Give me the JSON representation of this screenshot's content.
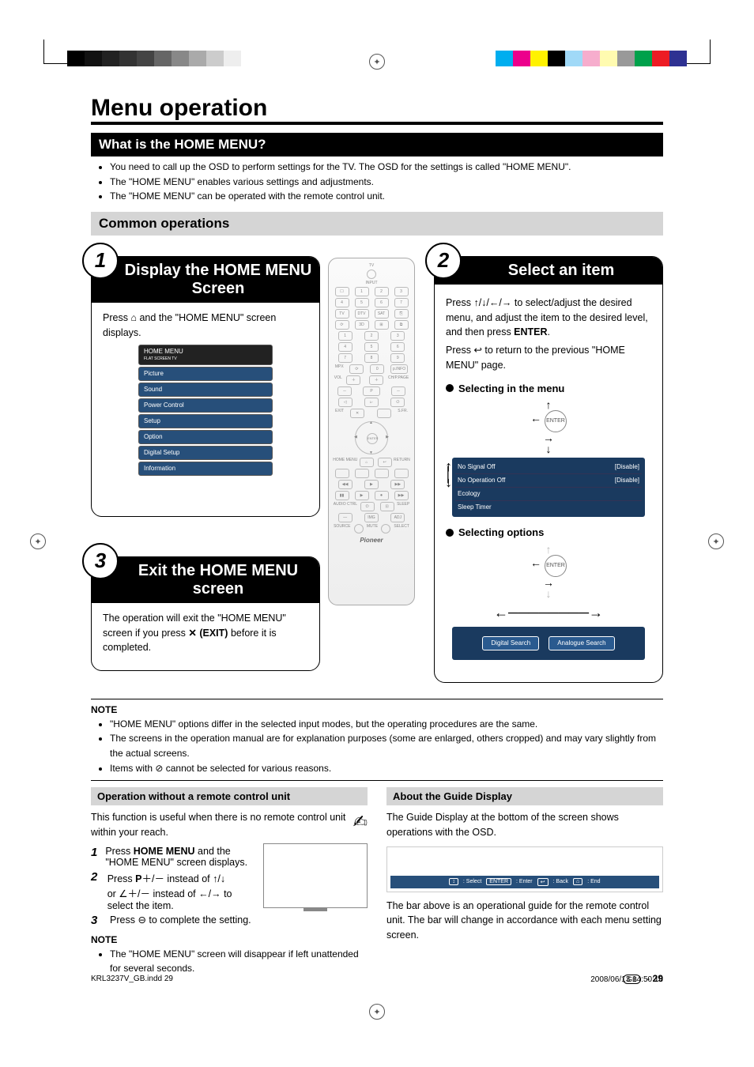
{
  "title": "Menu operation",
  "section1": {
    "heading": "What is the HOME MENU?",
    "bullets": [
      "You need to call up the OSD to perform settings for the TV. The OSD for the settings is called \"HOME MENU\".",
      "The \"HOME MENU\" enables various settings and adjustments.",
      "The \"HOME MENU\" can be operated with the remote control unit."
    ]
  },
  "section2": {
    "heading": "Common operations"
  },
  "step1": {
    "num": "1",
    "title": "Display the HOME MENU Screen",
    "text_a": "Press ",
    "text_b": " and the \"HOME MENU\" screen displays.",
    "menu": {
      "header": "HOME MENU",
      "header_sub": "FLAT SCREEN TV",
      "items": [
        "Picture",
        "Sound",
        "Power Control",
        "Setup",
        "Option",
        "Digital Setup",
        "Information"
      ]
    }
  },
  "step2": {
    "num": "2",
    "title": "Select an item",
    "text1_a": "Press ",
    "text1_b": " to select/adjust the desired menu, and adjust the item to the desired level, and then press ",
    "text1_enter": "ENTER",
    "text1_c": ".",
    "text2_a": "Press ",
    "text2_b": " to return to the previous \"HOME MENU\" page.",
    "sub1": "Selecting in the menu",
    "nav_label": "ENTER",
    "menu_sample": [
      {
        "l": "No Signal Off",
        "r": "[Disable]"
      },
      {
        "l": "No Operation Off",
        "r": "[Disable]"
      },
      {
        "l": "Ecology",
        "r": ""
      },
      {
        "l": "Sleep Timer",
        "r": ""
      }
    ],
    "sub2": "Selecting options",
    "options": [
      "Digital Search",
      "Analogue Search"
    ]
  },
  "step3": {
    "num": "3",
    "title": "Exit the HOME MENU screen",
    "text_a": "The operation will exit the \"HOME MENU\" screen if you press ",
    "exit_label": "(EXIT)",
    "text_b": " before it is completed."
  },
  "notes_after_diagram": {
    "heading": "NOTE",
    "bullets": [
      "\"HOME MENU\" options differ in the selected input modes, but the operating procedures are the same.",
      "The screens in the operation manual are for explanation purposes (some are enlarged, others cropped) and may vary slightly from the actual screens.",
      "Items with ⊘ cannot be selected for various reasons."
    ]
  },
  "left_sub": {
    "heading": "Operation without a remote control unit",
    "intro": "This function is useful when there is no remote control unit within your reach.",
    "steps": {
      "s1_a": "Press ",
      "s1_btn": "HOME MENU",
      "s1_b": " and the \"HOME MENU\" screen displays.",
      "s2_a": "Press ",
      "s2_p": "P",
      "s2_b": "＋/－ instead of ",
      "s2_c": " or ",
      "s2_d": "＋/－ instead of ",
      "s2_e": " to select the item.",
      "s3_a": "Press ",
      "s3_b": " to complete the setting."
    },
    "note_heading": "NOTE",
    "note_bullets": [
      "The \"HOME MENU\" screen will disappear if left unattended for several seconds."
    ]
  },
  "right_sub": {
    "heading": "About the Guide Display",
    "intro": "The Guide Display at the bottom of the screen shows operations with the OSD.",
    "guide_items": [
      ": Select",
      ": Enter",
      ": Back",
      ": End"
    ],
    "guide_keys": [
      "↕",
      "ENTER",
      "↩",
      "⌂"
    ],
    "outro": "The bar above is an operational guide for the remote control unit. The bar will change in accordance with each menu setting screen."
  },
  "remote": {
    "tv": "TV",
    "input": "INPUT",
    "row_a": [
      "☐",
      "1",
      "2",
      "3"
    ],
    "row_b": [
      "4",
      "5",
      "6",
      "7"
    ],
    "row_src": [
      "TV",
      "DTV",
      "SAT",
      "⎘"
    ],
    "row_ext": [
      "⟳",
      "3D",
      "⊞",
      "⧉"
    ],
    "row_n1": [
      "1",
      "2",
      "3"
    ],
    "row_n2": [
      "4",
      "5",
      "6"
    ],
    "row_n3": [
      "7",
      "8",
      "9"
    ],
    "row_n4_l": "MPX",
    "row_n4": [
      "⟳",
      "0",
      "p.INFO"
    ],
    "row_vol": [
      "VOL",
      "",
      "CH/P.PAGE"
    ],
    "row_exit": [
      "EXIT",
      "✕",
      "",
      "S.FR."
    ],
    "enter": "ENTER",
    "home": "HOME MENU",
    "ret": "RETURN",
    "row_tr": [
      "◀◀",
      "▶",
      "▶▶",
      "■",
      "▶▶|"
    ],
    "row_tr2": [
      "▮▮",
      "▶",
      "⏺",
      "▶▶"
    ],
    "row_misc": [
      "AUDIO CTRL",
      "",
      "SLEEP"
    ],
    "row_misc2": [
      "⏻",
      "",
      "⊡",
      "☐"
    ],
    "row_misc3": [
      "—",
      "IMG",
      "ADJ"
    ],
    "row_bot": [
      "SOURCE",
      "",
      "MUTE",
      "SELECT"
    ],
    "brand": "Pioneer"
  },
  "footer": {
    "file": "KRL3237V_GB.indd   29",
    "timestamp": "2008/06/13   14:50:18",
    "region": "GB",
    "page": "29"
  }
}
